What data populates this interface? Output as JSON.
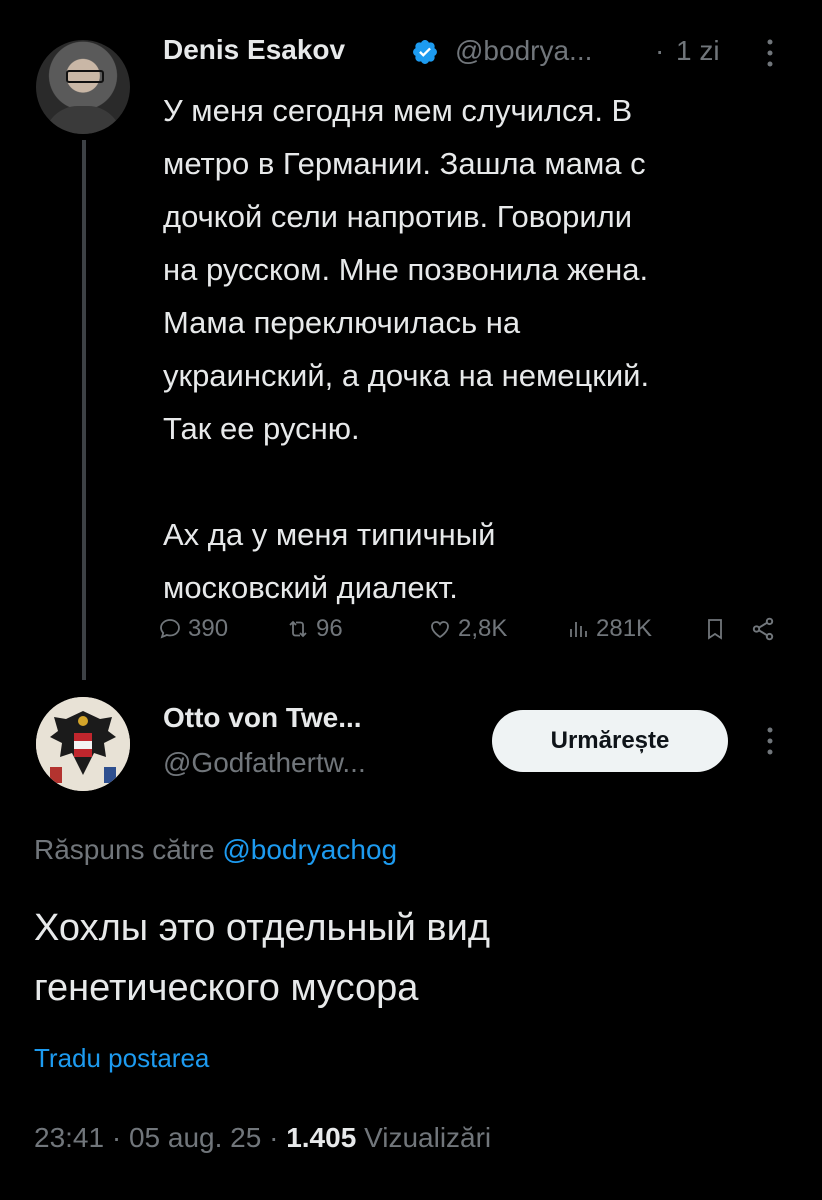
{
  "parent_tweet": {
    "author_name": "Denis Esakov",
    "handle": "@bodrya...",
    "separator": "·",
    "time": "1 zi",
    "text": "У меня сегодня мем случился. В\nметро в Германии. Зашла мама с\nдочкой сели напротив. Говорили\nна русском. Мне позвонила жена.\nМама переключилась на\nукраинский, а дочка на немецкий.\nТак ее русню.\n\nАх да у меня типичный\nмосковский диалект.",
    "replies": "390",
    "reposts": "96",
    "likes": "2,8K",
    "views": "281K"
  },
  "reply": {
    "author_name": "Otto von Twe...",
    "handle": "@Godfathertw...",
    "follow_label": "Urmărește",
    "reply_to_prefix": "Răspuns către",
    "reply_to_mention": "@bodryachog",
    "text": "Хохлы это отдельный вид\nгенетического мусора",
    "translate_label": "Tradu postarea",
    "time": "23:41",
    "separator": "·",
    "date": "05 aug. 25",
    "separator2": "·",
    "views_count": "1.405",
    "views_label": "Vizualizări"
  },
  "colors": {
    "background": "#000000",
    "text": "#e7e9ea",
    "muted": "#71767b",
    "accent": "#1d9bf0"
  }
}
